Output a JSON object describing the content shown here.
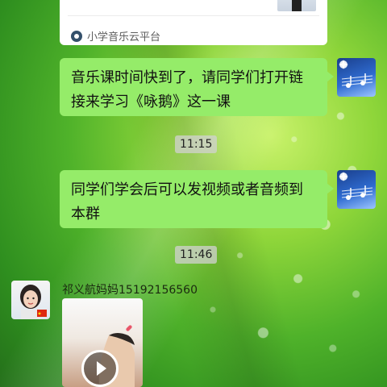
{
  "top_card": {
    "source_name": "小学音乐云平台",
    "icon": "mini-program-icon"
  },
  "messages": [
    {
      "type": "text",
      "side": "right",
      "text": "音乐课时间快到了，请同学们打开链接来学习《咏鹅》这一课",
      "avatar_icon": "music-notes-avatar"
    },
    {
      "type": "time",
      "text": "11:15"
    },
    {
      "type": "text",
      "side": "right",
      "text": "同学们学会后可以发视频或者音频到本群",
      "avatar_icon": "music-notes-avatar"
    },
    {
      "type": "time",
      "text": "11:46"
    },
    {
      "type": "video",
      "side": "left",
      "sender": "祁义航妈妈15192156560",
      "avatar_icon": "child-photo-avatar",
      "play_icon": "play-icon"
    }
  ],
  "colors": {
    "bubble_green": "#95ec69",
    "time_bg": "#d2d2d2",
    "card_bg": "#ffffff"
  }
}
